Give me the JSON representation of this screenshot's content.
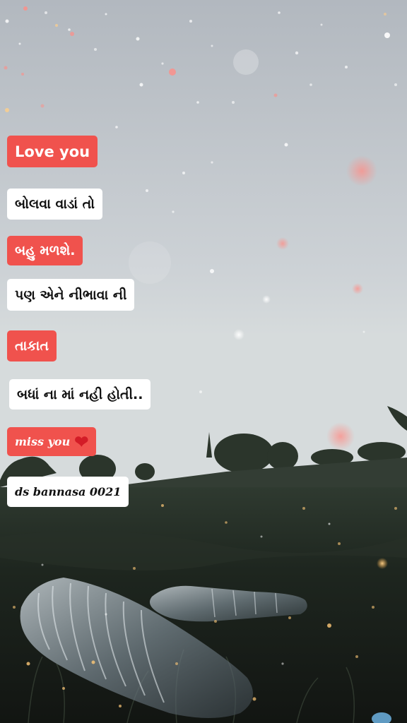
{
  "captions": {
    "line1": "Love you",
    "line2": "બોલવા વાડાં તો",
    "line3": "બહુ મળશે.",
    "line4": "પણ એને નીભાવા ની",
    "line5": "તાકાત",
    "line6": "બધાં ના માં નહી હોતી..",
    "line7": "miss you",
    "line7_emoji": "heart-emoji",
    "line8": "ds bannasa 0021"
  },
  "colors": {
    "sky_top": "#b6bcc3",
    "sky_bottom": "#d5dadd",
    "ground": "#1d221d",
    "caption_red": "#f0524d",
    "caption_white": "#ffffff",
    "heart": "#d31c27"
  }
}
